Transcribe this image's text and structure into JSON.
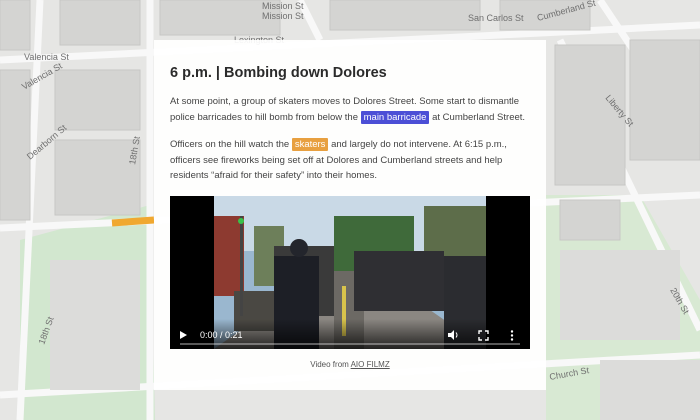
{
  "map": {
    "street_labels": [
      "Mission St",
      "Mission St",
      "Lexington St",
      "San Carlos St",
      "Cumberland St",
      "Valencia St",
      "Valencia St",
      "Dearborn St",
      "Liberty St",
      "18th St",
      "18th St",
      "Church St",
      "20th St"
    ],
    "colors": {
      "background": "#e6e6e4",
      "park": "#d2e7cf",
      "route_highlight": "#f0a830"
    }
  },
  "card": {
    "title": "6 p.m. | Bombing down Dolores",
    "para1": {
      "before": "At some point, a group of skaters moves to Dolores Street. Some start to dismantle police barricades to hill bomb from below the",
      "highlight": "main barricade",
      "after": "at Cumberland Street."
    },
    "para2": {
      "before": "Officers on the hill watch the",
      "highlight": "skaters",
      "after": "and largely do not intervene. At 6:15 p.m., officers see fireworks being set off at Dolores and Cumberland streets and help residents “afraid for their safety” into their homes."
    },
    "highlight_colors": {
      "blue": "#4c4fd6",
      "orange": "#e8a040"
    }
  },
  "video": {
    "time_display": "0:00 / 0:21",
    "progress": 0,
    "icons": [
      "play-icon",
      "volume-icon",
      "fullscreen-icon",
      "more-options-icon"
    ]
  },
  "caption": {
    "prefix": "Video from",
    "link_text": "AIO FILMZ"
  }
}
